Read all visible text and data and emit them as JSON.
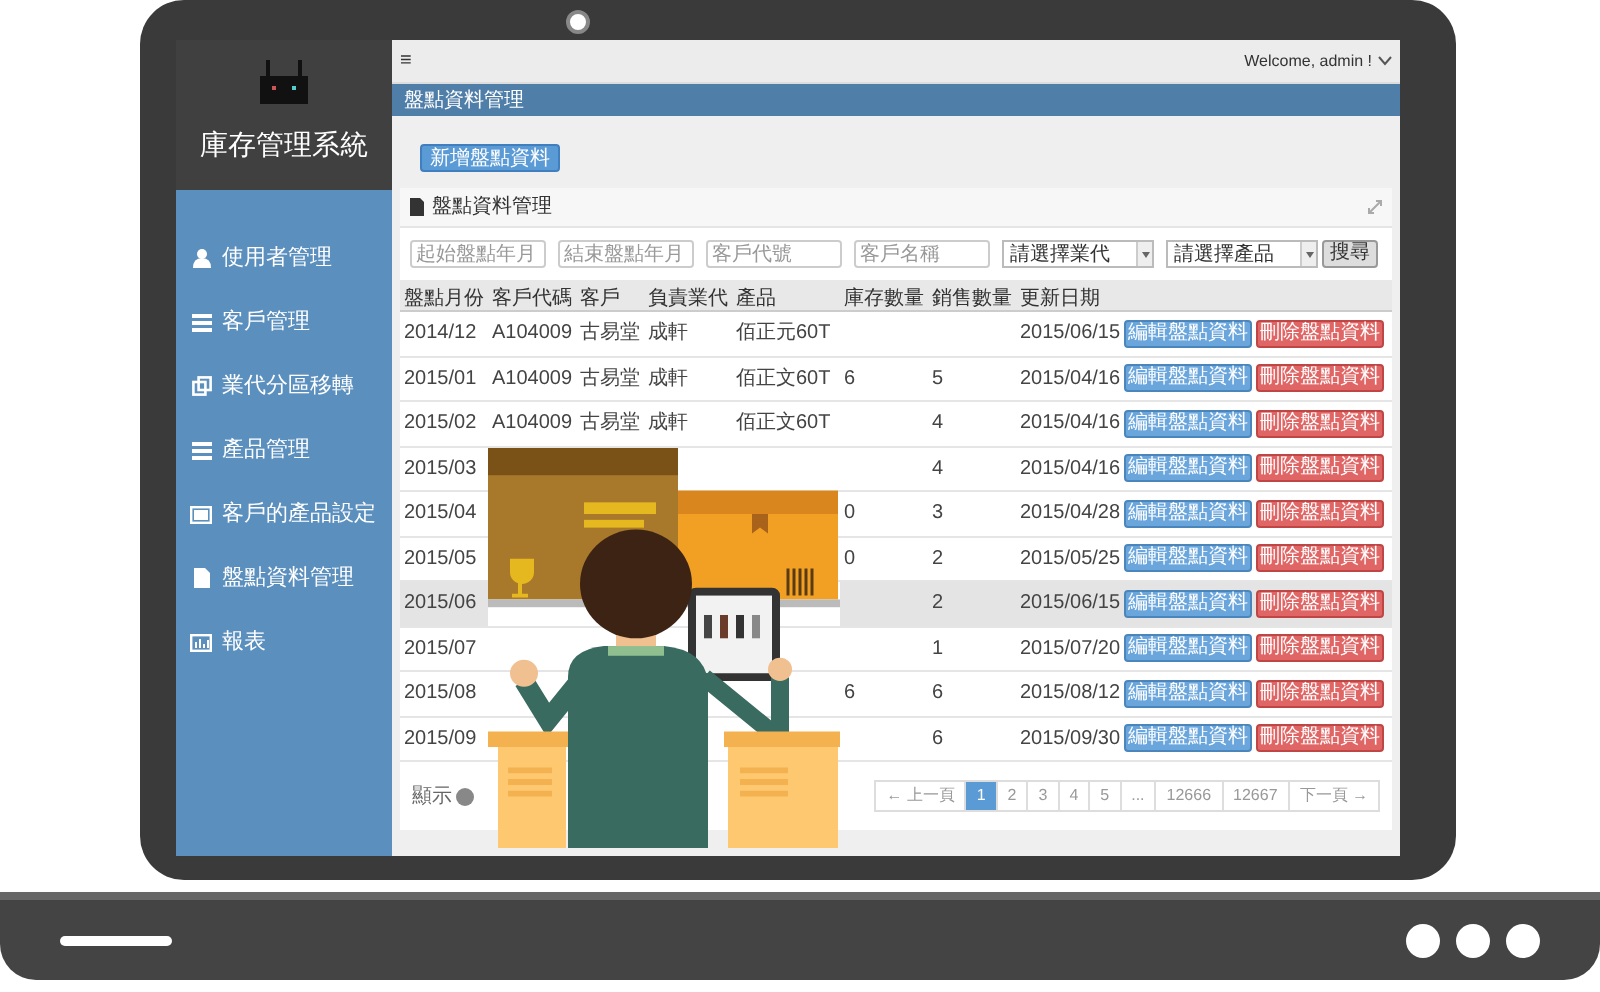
{
  "sidebar": {
    "title": "庫存管理系統",
    "items": [
      {
        "kind": "user",
        "label": "使用者管理"
      },
      {
        "kind": "list",
        "label": "客戶管理"
      },
      {
        "kind": "copy",
        "label": "業代分區移轉"
      },
      {
        "kind": "list",
        "label": "產品管理"
      },
      {
        "kind": "screen",
        "label": "客戶的產品設定"
      },
      {
        "kind": "file",
        "label": "盤點資料管理"
      },
      {
        "kind": "chart",
        "label": "報表"
      }
    ]
  },
  "topbar": {
    "menu": "≡",
    "welcome": "Welcome, admin !"
  },
  "page_header": "盤點資料管理",
  "add_button": "新增盤點資料",
  "panel": {
    "title": "盤點資料管理",
    "filters": [
      {
        "kind": "input",
        "placeholder": "起始盤點年月"
      },
      {
        "kind": "input",
        "placeholder": "結束盤點年月"
      },
      {
        "kind": "input",
        "placeholder": "客戶代號"
      },
      {
        "kind": "input",
        "placeholder": "客戶名稱"
      },
      {
        "kind": "select",
        "value": "請選擇業代"
      },
      {
        "kind": "select",
        "value": "請選擇產品"
      }
    ],
    "search_button": "搜尋",
    "table": {
      "columns": [
        "盤點月份",
        "客戶代碼",
        "客戶",
        "負責業代",
        "產品",
        "庫存數量",
        "銷售數量",
        "更新日期"
      ],
      "rows": [
        {
          "highlighted": false,
          "cells": [
            "2014/12",
            "A104009",
            "古易堂",
            "成軒",
            "佰正元60T",
            null,
            null,
            "2015/06/15"
          ],
          "actions": [
            "編輯盤點資料",
            "刪除盤點資料"
          ]
        },
        {
          "highlighted": false,
          "cells": [
            "2015/01",
            "A104009",
            "古易堂",
            "成軒",
            "佰正文60T",
            "6",
            "5",
            "2015/04/16"
          ],
          "actions": [
            "編輯盤點資料",
            "刪除盤點資料"
          ]
        },
        {
          "highlighted": false,
          "cells": [
            "2015/02",
            "A104009",
            "古易堂",
            "成軒",
            "佰正文60T",
            null,
            "4",
            "2015/04/16"
          ],
          "actions": [
            "編輯盤點資料",
            "刪除盤點資料"
          ]
        },
        {
          "highlighted": false,
          "cells": [
            "2015/03",
            null,
            null,
            null,
            null,
            null,
            "4",
            "2015/04/16"
          ],
          "actions": [
            "編輯盤點資料",
            "刪除盤點資料"
          ]
        },
        {
          "highlighted": false,
          "cells": [
            "2015/04",
            null,
            null,
            null,
            null,
            "0",
            "3",
            "2015/04/28"
          ],
          "actions": [
            "編輯盤點資料",
            "刪除盤點資料"
          ]
        },
        {
          "highlighted": false,
          "cells": [
            "2015/05",
            null,
            null,
            null,
            null,
            "0",
            "2",
            "2015/05/25"
          ],
          "actions": [
            "編輯盤點資料",
            "刪除盤點資料"
          ]
        },
        {
          "highlighted": true,
          "cells": [
            "2015/06",
            null,
            null,
            null,
            null,
            null,
            "2",
            "2015/06/15"
          ],
          "actions": [
            "編輯盤點資料",
            "刪除盤點資料"
          ]
        },
        {
          "highlighted": false,
          "cells": [
            "2015/07",
            null,
            null,
            null,
            null,
            null,
            "1",
            "2015/07/20"
          ],
          "actions": [
            "編輯盤點資料",
            "刪除盤點資料"
          ]
        },
        {
          "highlighted": false,
          "cells": [
            "2015/08",
            null,
            null,
            null,
            null,
            "6",
            "6",
            "2015/08/12"
          ],
          "actions": [
            "編輯盤點資料",
            "刪除盤點資料"
          ]
        },
        {
          "highlighted": false,
          "cells": [
            "2015/09",
            null,
            null,
            null,
            null,
            null,
            "6",
            "2015/09/30"
          ],
          "actions": [
            "編輯盤點資料",
            "刪除盤點資料"
          ]
        }
      ]
    },
    "footer_label": "顯示",
    "pagination": {
      "prev": "← 上一頁",
      "next": "下一頁 →",
      "pages": [
        {
          "label": "1",
          "selected": true
        },
        {
          "label": "2",
          "selected": false
        },
        {
          "label": "3",
          "selected": false
        },
        {
          "label": "4",
          "selected": false
        },
        {
          "label": "5",
          "selected": false
        },
        {
          "label": "...",
          "selected": false
        },
        {
          "label": "12666",
          "selected": false
        },
        {
          "label": "12667",
          "selected": false
        }
      ]
    }
  }
}
